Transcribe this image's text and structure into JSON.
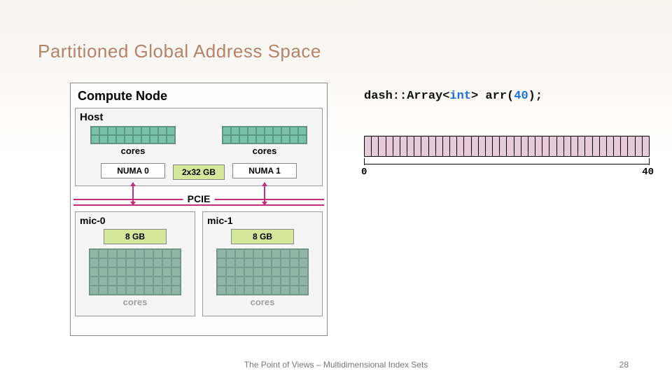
{
  "slide": {
    "title": "Partitioned Global Address Space",
    "footer": "The Point of Views – Multidimensional Index Sets",
    "page": "28"
  },
  "node": {
    "title": "Compute Node",
    "host": {
      "title": "Host",
      "cores_label": "cores",
      "mem_label": "2x32 GB",
      "numa0": "NUMA 0",
      "numa1": "NUMA 1"
    },
    "pcie": "PCIE",
    "mic0": {
      "title": "mic-0",
      "mem": "8 GB",
      "cores_label": "cores"
    },
    "mic1": {
      "title": "mic-1",
      "mem": "8 GB",
      "cores_label": "cores"
    }
  },
  "code": {
    "ns": "dash::Array<",
    "type": "int",
    "after_type": "> arr(",
    "size": "40",
    "tail": ");"
  },
  "array": {
    "cells": 40,
    "axis_start": "0",
    "axis_end": "40"
  },
  "chart_data": {
    "type": "table",
    "title": "Partitioned Global Address Space compute-node layout",
    "host": {
      "numa_domains": 2,
      "cores_per_numa": 20,
      "memory_per_numa_gb": 32,
      "memory_label": "2x32 GB"
    },
    "accelerators": [
      {
        "name": "mic-0",
        "memory_gb": 8,
        "cores_shown": 50
      },
      {
        "name": "mic-1",
        "memory_gb": 8,
        "cores_shown": 50
      }
    ],
    "interconnect": "PCIE",
    "array_declaration": {
      "container": "dash::Array<int>",
      "variable": "arr",
      "length": 40,
      "index_range": [
        0,
        40
      ]
    }
  }
}
